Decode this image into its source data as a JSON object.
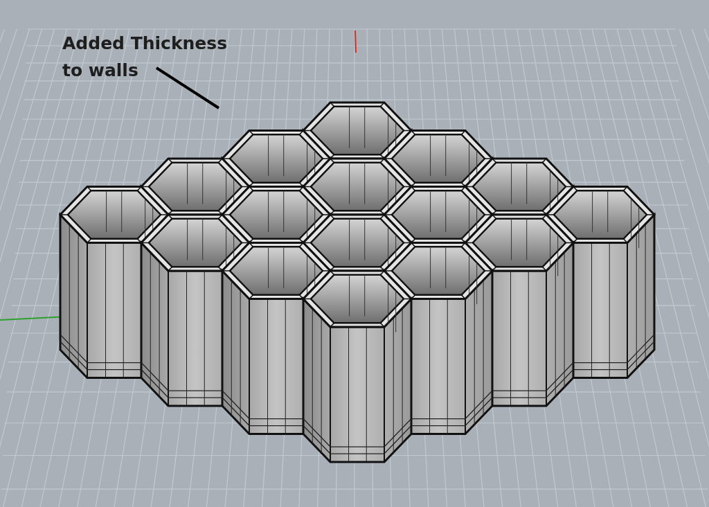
{
  "viewport": {
    "annotation": {
      "text": "Added Thickness\nto walls"
    }
  }
}
